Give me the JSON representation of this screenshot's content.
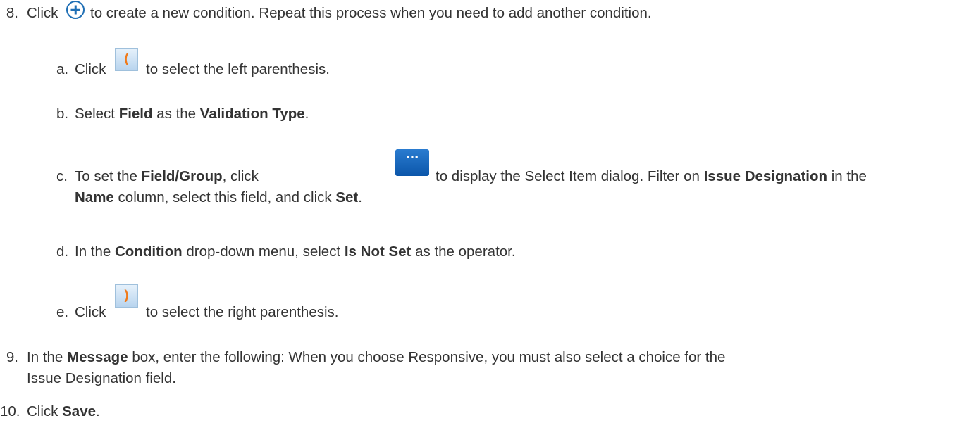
{
  "step8": {
    "number": "8.",
    "click": "Click",
    "rest": "to create a new condition. Repeat this process when you need to add another condition."
  },
  "step8a": {
    "letter": "a.",
    "click": "Click",
    "icon_text": "(",
    "rest": "to select the left parenthesis."
  },
  "step8b": {
    "letter": "b.",
    "p1": "Select",
    "b1": "Field",
    "p2": "as the",
    "b2": "Validation Type",
    "p3": "."
  },
  "step8c": {
    "letter": "c.",
    "p1": "To set the",
    "b1": "Field/Group",
    "p2": ", click",
    "icon_text": "···",
    "p3": "to display the Select Item dialog. Filter on",
    "b2": "Issue Designation",
    "p4": "in the",
    "b3": "Name",
    "p5": "column, select this field, and click",
    "b4": "Set",
    "p6": "."
  },
  "step8d": {
    "letter": "d.",
    "p1": "In the",
    "b1": "Condition",
    "p2": "drop-down menu, select",
    "b2": "Is Not Set",
    "p3": "as the operator."
  },
  "step8e": {
    "letter": "e.",
    "click": "Click",
    "icon_text": ")",
    "rest": "to select the right parenthesis."
  },
  "step9": {
    "number": "9.",
    "p1": "In the",
    "b1": "Message",
    "p2": "box, enter the following: When you choose Responsive, you must also select a choice for the",
    "p3": "Issue Designation field."
  },
  "step10": {
    "number": "10.",
    "p1": "Click",
    "b1": "Save",
    "p2": "."
  }
}
